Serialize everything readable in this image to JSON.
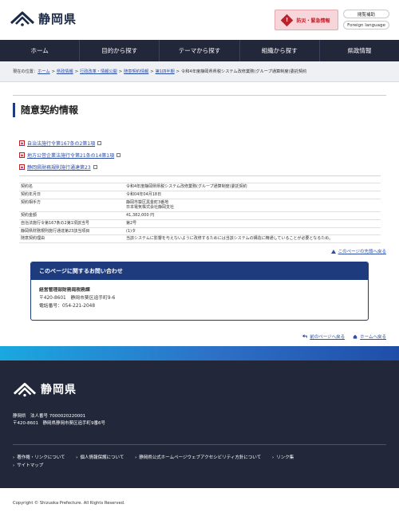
{
  "header": {
    "logo_text": "静岡県",
    "disaster_label": "防災・緊急情報",
    "links": [
      "閲覧補助",
      "Foreign language"
    ]
  },
  "nav": [
    "ホーム",
    "目的から探す",
    "テーマから探す",
    "組織から探す",
    "県政情報"
  ],
  "breadcrumb": {
    "prefix": "現在の位置：",
    "items": [
      "ホーム",
      "県政情報",
      "行政改革・情報公開",
      "随意契約情報",
      "第1四半期"
    ],
    "current": "令和4年度静岡県県税システム改修業務(グループ通算制度)委託契約"
  },
  "page_title": "随意契約情報",
  "law_links": [
    "自治法施行令第167条の2第1項",
    "地方公営企業法施行令第21条の14第1項",
    "静岡県財務規則施行通達第23"
  ],
  "contract": [
    {
      "label": "契約名",
      "value": "令和4年度静岡県県税システム改修業務(グループ通算制度)委託契約"
    },
    {
      "label": "契約年月日",
      "value": "令和04年04月18日"
    },
    {
      "label": "契約相手方",
      "value": "静岡市葵区黒金町3番地\n日本電気株式会社静岡支社"
    },
    {
      "label": "契約金額",
      "value": "41,382,000 円"
    },
    {
      "label": "自治法施行令第167条の2第1項該当号",
      "value": "第2号"
    },
    {
      "label": "静岡県財務規則施行通達第23該当項目",
      "value": "(1)タ"
    },
    {
      "label": "随意契約理由",
      "value": "当該システムに影響を与えないように改修するためには当該システムの構造に精通していることが必要となるため。"
    }
  ],
  "back_to_top": "このページの先頭へ戻る",
  "contact": {
    "heading": "このページに関するお問い合わせ",
    "dept": "経営管理部財務局税務課",
    "address": "〒420-8601　静岡市葵区追手町9-6",
    "phone": "電話番号：054-221-2048"
  },
  "page_nav": {
    "prev": "前のページへ戻る",
    "home": "ホームへ戻る"
  },
  "footer": {
    "logo_text": "静岡県",
    "corp": "静岡県　法人番号 7000020220001",
    "address": "〒420-8601　静岡県静岡市葵区追手町9番6号",
    "links": [
      "著作権・リンクについて",
      "個人情報保護について",
      "静岡県公式ホームページウェブアクセシビリティ方針について",
      "リンク集",
      "サイトマップ"
    ]
  },
  "copyright": "Copyright © Shizuoka Prefecture. All Rights Reserved.",
  "colors": {
    "navy": "#22283a",
    "accent_blue": "#1d3b7d",
    "link_blue": "#2a4da8",
    "alert_red": "#c0202a"
  }
}
